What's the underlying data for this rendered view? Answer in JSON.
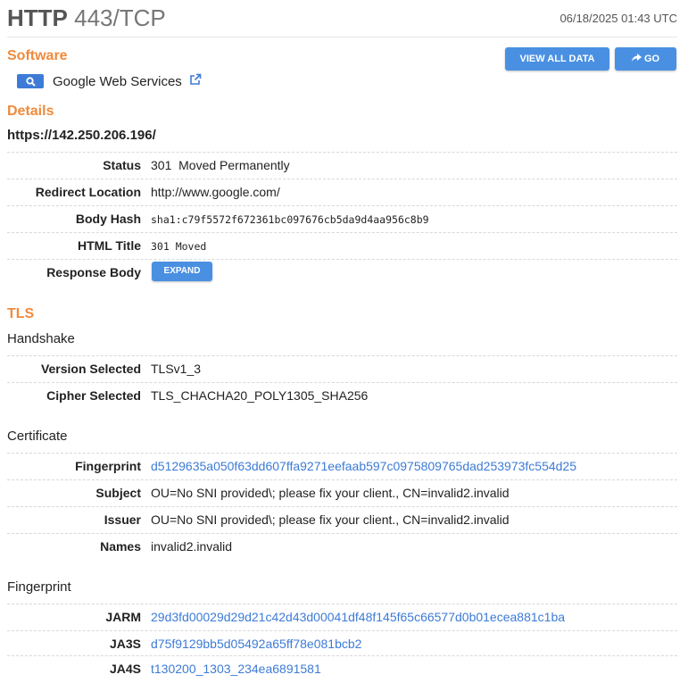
{
  "header": {
    "protocol": "HTTP",
    "port": "443/TCP",
    "timestamp": "06/18/2025 01:43 UTC"
  },
  "buttons": {
    "view_all_data": "VIEW ALL DATA",
    "go": "GO"
  },
  "software": {
    "heading": "Software",
    "name": "Google Web Services"
  },
  "details": {
    "heading": "Details",
    "url": "https://142.250.206.196/",
    "rows": [
      {
        "label": "Status",
        "value": "301  Moved Permanently"
      },
      {
        "label": "Redirect Location",
        "value": "http://www.google.com/"
      },
      {
        "label": "Body Hash",
        "value": "sha1:c79f5572f672361bc097676cb5da9d4aa956c8b9"
      },
      {
        "label": "HTML Title",
        "value": "301 Moved"
      },
      {
        "label": "Response Body",
        "button": "EXPAND"
      }
    ]
  },
  "tls": {
    "heading": "TLS",
    "handshake": {
      "title": "Handshake",
      "rows": [
        {
          "label": "Version Selected",
          "value": "TLSv1_3"
        },
        {
          "label": "Cipher Selected",
          "value": "TLS_CHACHA20_POLY1305_SHA256"
        }
      ]
    },
    "certificate": {
      "title": "Certificate",
      "rows": [
        {
          "label": "Fingerprint",
          "value": "d5129635a050f63dd607ffa9271eefaab597c0975809765dad253973fc554d25"
        },
        {
          "label": "Subject",
          "value": "OU=No SNI provided\\; please fix your client., CN=invalid2.invalid"
        },
        {
          "label": "Issuer",
          "value": "OU=No SNI provided\\; please fix your client., CN=invalid2.invalid"
        },
        {
          "label": "Names",
          "value": "invalid2.invalid"
        }
      ]
    },
    "fingerprint": {
      "title": "Fingerprint",
      "rows": [
        {
          "label": "JARM",
          "value": "29d3fd00029d29d21c42d43d00041df48f145f65c66577d0b01ecea881c1ba"
        },
        {
          "label": "JA3S",
          "value": "d75f9129bb5d05492a65ff78e081bcb2"
        },
        {
          "label": "JA4S",
          "value": "t130200_1303_234ea6891581"
        }
      ]
    }
  },
  "colors": {
    "accent_orange": "#f08a3c",
    "button_blue": "#4a90e2",
    "link_blue": "#3d7bd6"
  }
}
